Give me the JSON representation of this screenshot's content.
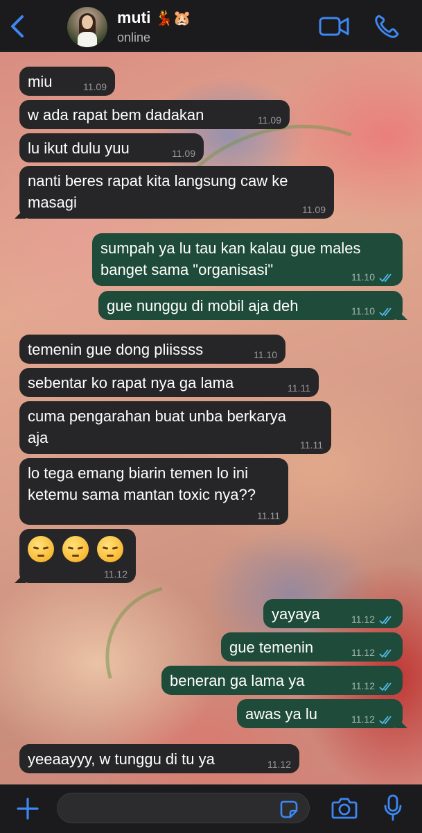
{
  "header": {
    "contact_name": "muti",
    "contact_emoji": "💃🐹",
    "status": "online",
    "icons": {
      "back": "chevron-left-icon",
      "video": "video-camera-icon",
      "call": "phone-icon"
    },
    "accent_color": "#3d88f2"
  },
  "messages": [
    {
      "dir": "in",
      "text": "miu",
      "time": "11.09"
    },
    {
      "dir": "in",
      "text": "w ada rapat bem dadakan",
      "time": "11.09"
    },
    {
      "dir": "in",
      "text": "lu ikut dulu yuu",
      "time": "11.09"
    },
    {
      "dir": "in",
      "text": "nanti beres rapat kita langsung caw ke masagi",
      "time": "11.09"
    },
    {
      "dir": "out",
      "text": "sumpah ya lu tau kan kalau gue males banget sama \"organisasi\"",
      "time": "11.10"
    },
    {
      "dir": "out",
      "text": "gue nunggu di mobil aja deh",
      "time": "11.10"
    },
    {
      "dir": "in",
      "text": "temenin gue dong pliissss",
      "time": "11.10"
    },
    {
      "dir": "in",
      "text": "sebentar ko rapat nya ga lama",
      "time": "11.11"
    },
    {
      "dir": "in",
      "text": "cuma pengarahan buat unba berkarya aja",
      "time": "11.11"
    },
    {
      "dir": "in",
      "text": "lo tega emang biarin temen lo ini ketemu sama mantan toxic nya??",
      "time": "11.11"
    },
    {
      "dir": "in",
      "text": "😔😔😔",
      "time": "11.12"
    },
    {
      "dir": "out",
      "text": "yayaya",
      "time": "11.12"
    },
    {
      "dir": "out",
      "text": "gue temenin",
      "time": "11.12"
    },
    {
      "dir": "out",
      "text": "beneran ga lama ya",
      "time": "11.12"
    },
    {
      "dir": "out",
      "text": "awas ya lu",
      "time": "11.12"
    },
    {
      "dir": "in",
      "text": "yeeaayyy, w tunggu di tu ya",
      "time": "11.12"
    }
  ],
  "composer": {
    "placeholder": "",
    "icons": {
      "add": "plus-icon",
      "sticker": "sticker-icon",
      "camera": "camera-icon",
      "mic": "microphone-icon"
    }
  },
  "colors": {
    "incoming_bubble": "#262628",
    "outgoing_bubble": "#1f4b3b",
    "read_ticks": "#53bdeb"
  }
}
